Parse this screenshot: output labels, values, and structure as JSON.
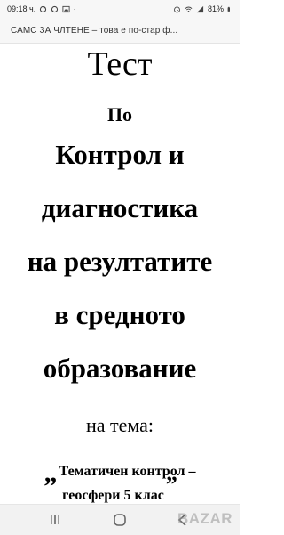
{
  "status_bar": {
    "time": "09:18 ч.",
    "battery": "81%",
    "icons": [
      "sync-icon",
      "sync-icon",
      "image-icon",
      "dot-icon",
      "alarm-icon",
      "wifi-icon",
      "signal-icon",
      "battery-icon"
    ]
  },
  "banner": {
    "text": "САМС ЗА ЧЛТЕНЕ – това е по-стар ф..."
  },
  "document": {
    "title": "Тест",
    "line_po": "По",
    "line_kontrol": "Контрол и",
    "line_diag": "диагностика",
    "line_na": "на резултатите",
    "line_v": "в средното",
    "line_obr": "образование",
    "line_tema": "на тема:",
    "quote_open": "„",
    "topic_line1": "Тематичен контрол –",
    "topic_line2": "геосфери 5 клас",
    "quote_close": "”"
  },
  "watermark": {
    "text": "BAZAR"
  }
}
